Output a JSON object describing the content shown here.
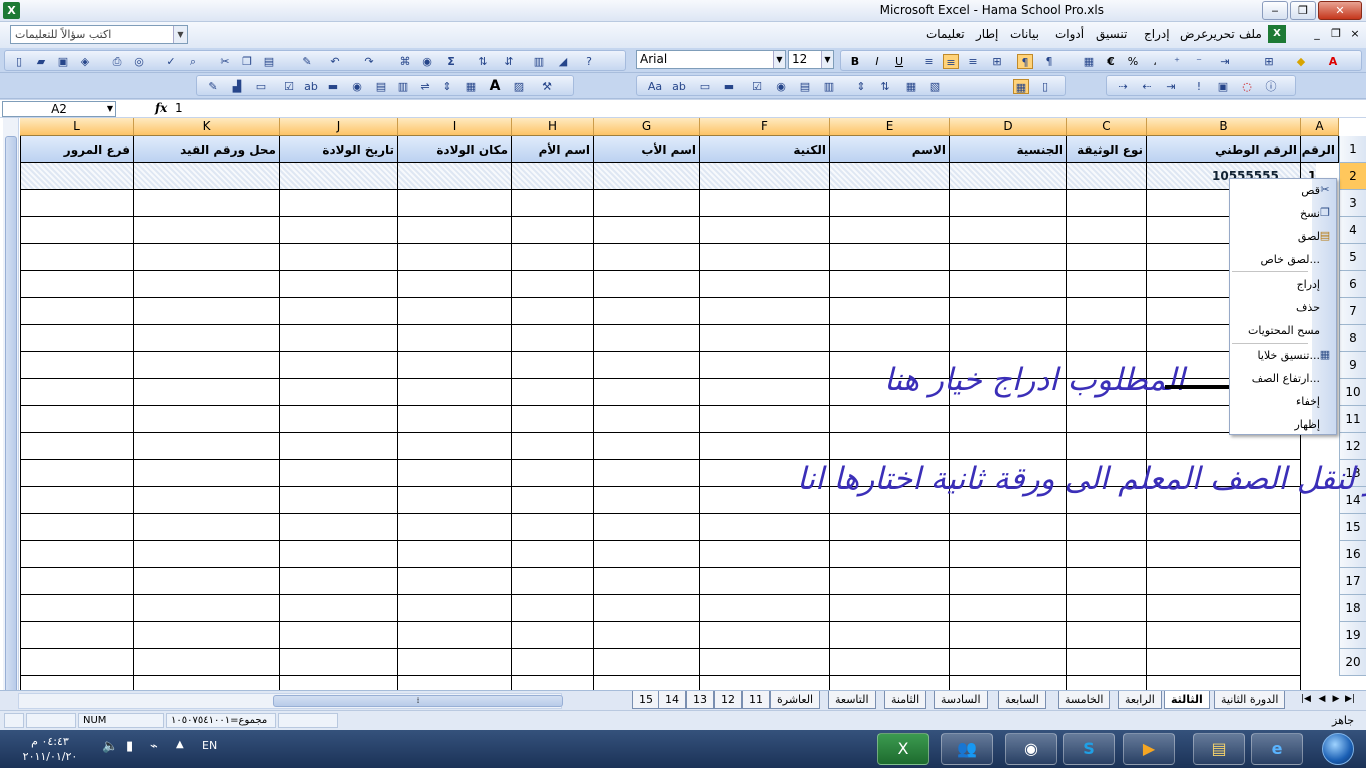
{
  "window": {
    "title": "Microsoft Excel - Hama School Pro.xls",
    "controls": {
      "minimize": "‒",
      "restore": "❐",
      "close": "✕"
    },
    "icon": "excel-icon"
  },
  "menubar": {
    "ask_placeholder": "اكتب سؤالاً للتعليمات",
    "items": [
      "ملف",
      "تحرير",
      "عرض",
      "إدراج",
      "تنسيق",
      "أدوات",
      "بيانات",
      "إطار",
      "تعليمات"
    ],
    "doc_controls": {
      "minimize": "_",
      "restore": "❐",
      "close": "×"
    }
  },
  "toolbar": {
    "font_name": "Arial",
    "font_size": "12",
    "bold": "B",
    "italic": "I",
    "underline": "U",
    "euro": "€",
    "percent": "%",
    "comma": "،",
    "sum": "Σ",
    "big_a": "A"
  },
  "formula_bar": {
    "name_box": "A2",
    "fx": "fx",
    "value": "1"
  },
  "sheet": {
    "columns": [
      "L",
      "K",
      "J",
      "I",
      "H",
      "G",
      "F",
      "E",
      "D",
      "C",
      "B",
      "A"
    ],
    "header_row": [
      "فرع المرور",
      "محل ورقم القيد",
      "تاريخ الولادة",
      "مكان الولادة",
      "اسم الأم",
      "اسم الأب",
      "الكنية",
      "الاسم",
      "الجنسية",
      "نوع الوثيقة",
      "الرقم الوطني",
      "الرقم"
    ],
    "row_numbers": [
      "1",
      "2",
      "3",
      "4",
      "5",
      "6",
      "7",
      "8",
      "9",
      "10",
      "11",
      "12",
      "13",
      "14",
      "15",
      "16",
      "17",
      "18",
      "19",
      "20"
    ],
    "row2_b_value": "10555555",
    "row2_a_value": "1"
  },
  "context_menu": {
    "items": [
      {
        "label": "قص",
        "icon": "scissors-icon"
      },
      {
        "label": "نسخ",
        "icon": "copy-icon"
      },
      {
        "label": "لصق",
        "icon": "paste-icon"
      },
      {
        "label": "لصق خاص...",
        "icon": ""
      },
      {
        "label": "إدراج",
        "icon": ""
      },
      {
        "label": "حذف",
        "icon": ""
      },
      {
        "label": "مسح المحتويات",
        "icon": ""
      },
      {
        "label": "تنسيق خلايا...",
        "icon": "format-cells-icon"
      },
      {
        "label": "ارتفاع الصف...",
        "icon": ""
      },
      {
        "label": "إخفاء",
        "icon": ""
      },
      {
        "label": "إظهار",
        "icon": ""
      }
    ]
  },
  "annotations": {
    "line1": "المطلوب ادراج خيار هنا",
    "line2": "او زر لنقل الصف المعلم الى ورقة ثانية اختارها انا",
    "arrow_color": "#000000",
    "text_color": "#3b2fb8"
  },
  "sheet_tabs": {
    "tabs": [
      "الدورة الثانية",
      "الثالثة",
      "الرابعة",
      "الخامسة",
      "السابعة",
      "السادسة",
      "الثامنة",
      "التاسعة",
      "العاشرة",
      "11",
      "12",
      "13",
      "14",
      "15"
    ],
    "active_index": 1
  },
  "status_bar": {
    "ready": "جاهز",
    "sum": "مجموع=١٠٥٠٧٥٤١٠٠١",
    "num": "NUM"
  },
  "taskbar": {
    "time": "٠٤:٤٣ م",
    "date": "٢٠١١/٠١/٢٠",
    "lang": "EN",
    "apps": [
      "excel-icon",
      "messenger-icon",
      "network-globe-icon",
      "skype-icon",
      "media-player-icon",
      "explorer-folder-icon",
      "internet-explorer-icon"
    ]
  }
}
